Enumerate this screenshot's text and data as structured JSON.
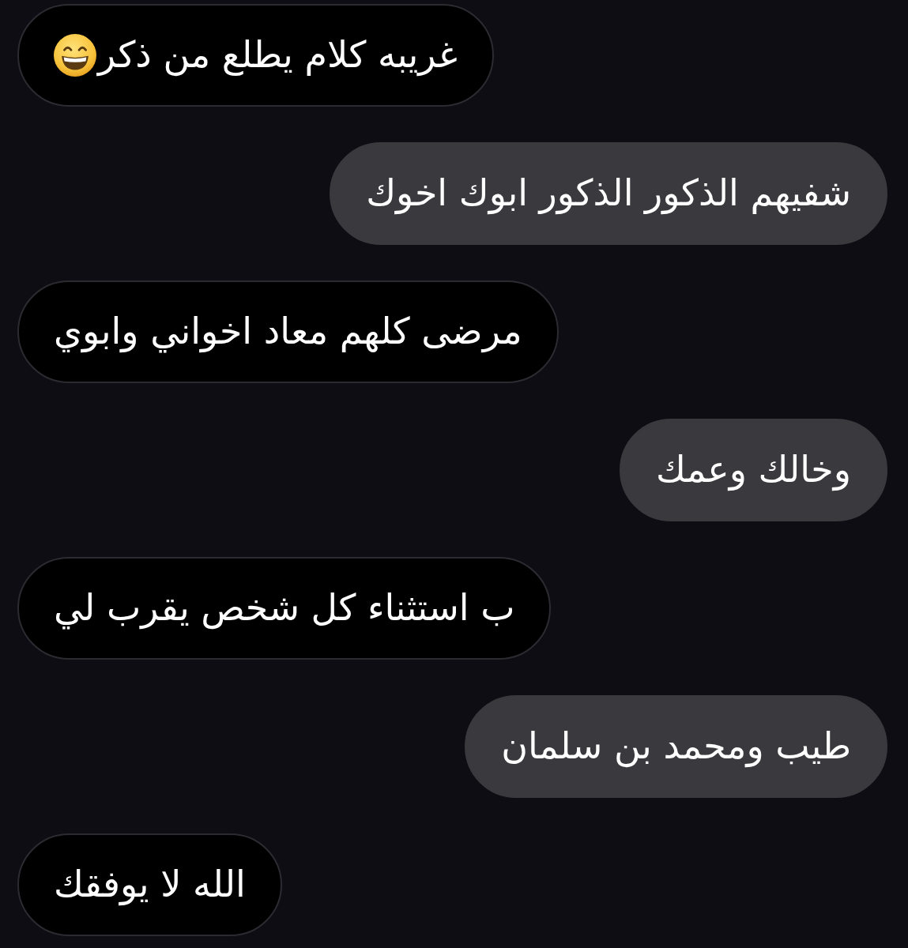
{
  "messages": [
    {
      "kind": "received",
      "text": "غريبه كلام يطلع من ذكر",
      "emoji": true
    },
    {
      "kind": "sent",
      "text": "شفيهم الذكور الذكور ابوك اخوك",
      "emoji": false
    },
    {
      "kind": "received",
      "text": "مرضى كلهم معاد اخواني وابوي",
      "emoji": false
    },
    {
      "kind": "sent",
      "text": "وخالك وعمك",
      "emoji": false
    },
    {
      "kind": "received",
      "text": "ب استثناء كل شخص يقرب لي",
      "emoji": false
    },
    {
      "kind": "sent",
      "text": "طيب ومحمد بن سلمان",
      "emoji": false
    },
    {
      "kind": "received",
      "text": "الله لا يوفقك",
      "emoji": false
    }
  ]
}
